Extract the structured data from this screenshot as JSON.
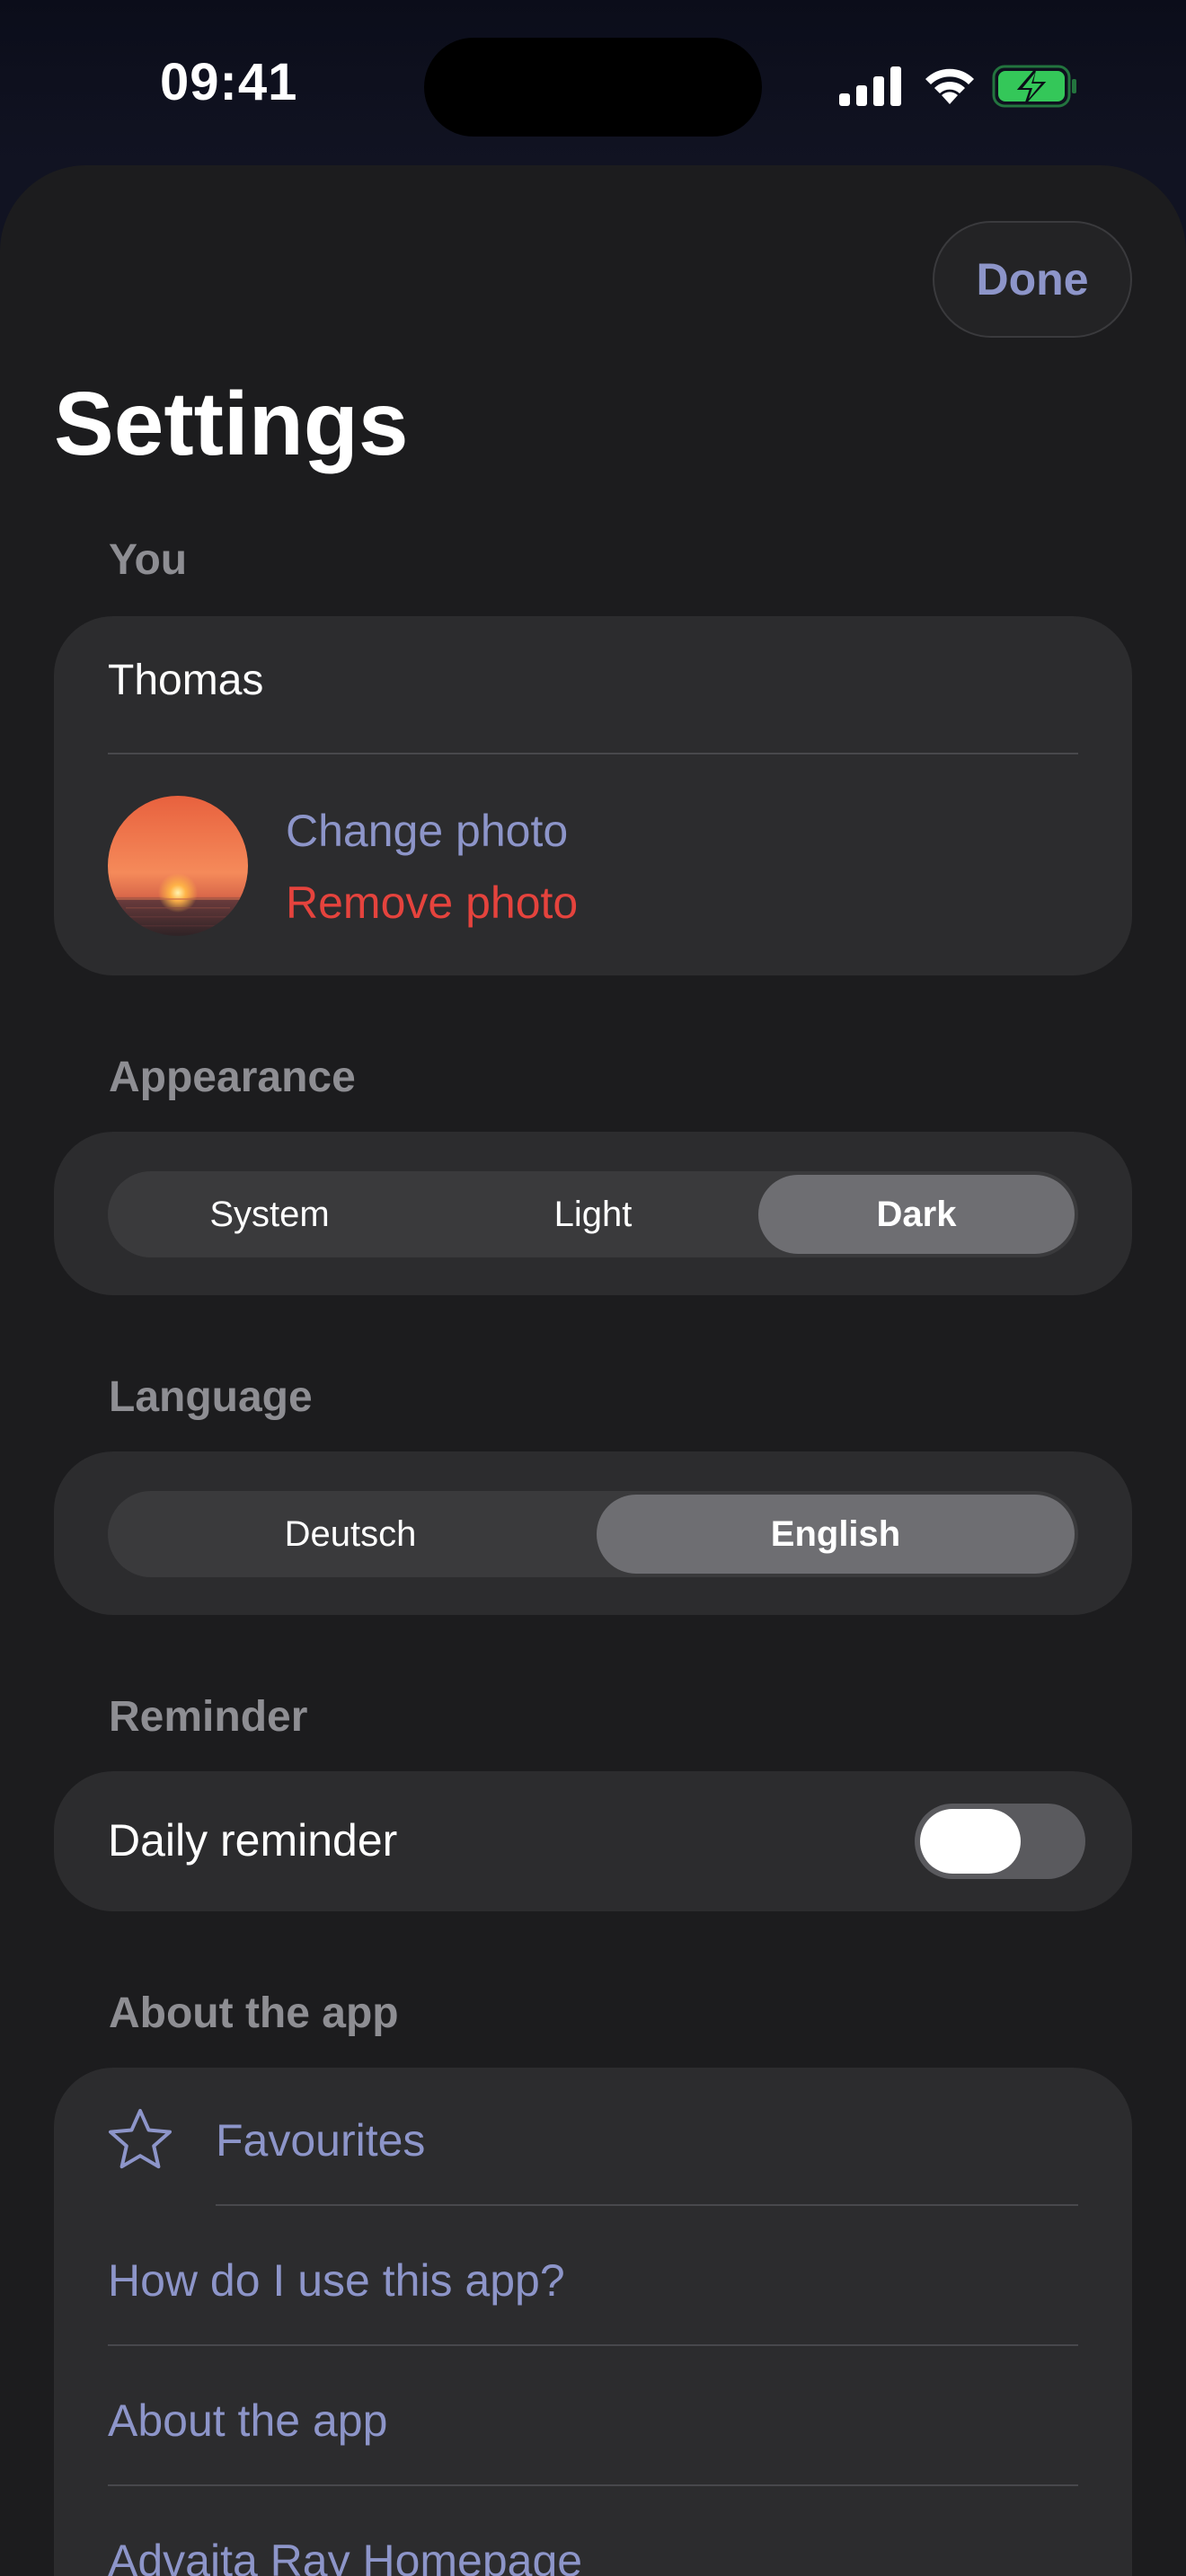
{
  "status_bar": {
    "time": "09:41",
    "icons": [
      "cellular-signal-icon",
      "wifi-icon",
      "battery-charging-icon"
    ],
    "battery_color": "#34c759"
  },
  "header": {
    "done_label": "Done",
    "title": "Settings"
  },
  "colors": {
    "accent": "#8d95c9",
    "danger": "#e5433d",
    "sheet_background": "#1c1c1e",
    "card_background": "#2c2c2e"
  },
  "you_section": {
    "header": "You",
    "name": "Thomas",
    "change_photo_label": "Change photo",
    "remove_photo_label": "Remove photo"
  },
  "appearance_section": {
    "header": "Appearance",
    "options": [
      "System",
      "Light",
      "Dark"
    ],
    "selected": "Dark"
  },
  "language_section": {
    "header": "Language",
    "options": [
      "Deutsch",
      "English"
    ],
    "selected": "English"
  },
  "reminder_section": {
    "header": "Reminder",
    "daily_reminder_label": "Daily reminder",
    "daily_reminder_on": false
  },
  "about_section": {
    "header": "About the app",
    "items": [
      {
        "label": "Favourites",
        "icon": "star-icon"
      },
      {
        "label": "How do I use this app?"
      },
      {
        "label": "About the app"
      },
      {
        "label": "Advaita Ray Homepage"
      }
    ]
  }
}
